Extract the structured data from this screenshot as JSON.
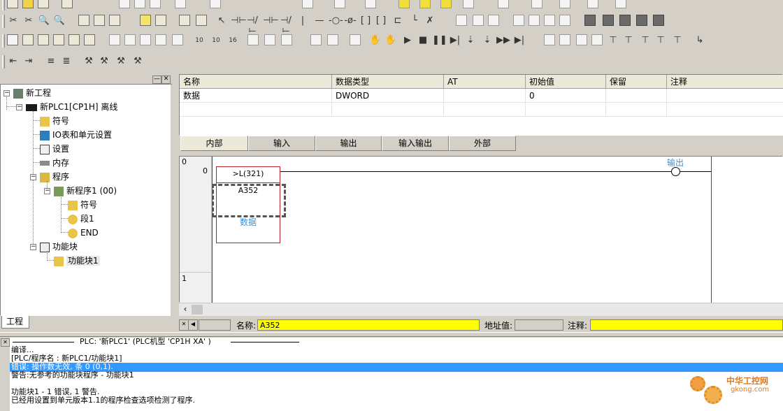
{
  "project_tree": {
    "tab_label": "工程",
    "root": "新工程",
    "plc": "新PLC1[CP1H] 离线",
    "plc_children": [
      "符号",
      "IO表和单元设置",
      "设置",
      "内存"
    ],
    "programs_label": "程序",
    "program_name": "新程序1 (00)",
    "program_children": [
      "符号",
      "段1",
      "END"
    ],
    "function_blocks_label": "功能块",
    "function_block_item": "功能块1"
  },
  "variable_table": {
    "headers": [
      "名称",
      "数据类型",
      "AT",
      "初始值",
      "保留",
      "注释"
    ],
    "row": [
      "数据",
      "DWORD",
      "",
      "0",
      "",
      ""
    ],
    "tabs": [
      "内部",
      "输入",
      "输出",
      "输入输出",
      "外部"
    ],
    "active_tab": "内部"
  },
  "ladder": {
    "rung0_number": "0",
    "rung0_step": "0",
    "rung1_number": "1",
    "instruction": ">L(321)",
    "operand1": "A352",
    "operand2": "数据",
    "coil_label": "输出"
  },
  "status": {
    "name_label": "名称:",
    "name_value": "A352",
    "address_label": "地址值:",
    "comment_label": "注释:"
  },
  "output": {
    "title": "PLC: '新PLC1' (PLC机型 'CP1H XA' )",
    "lines": [
      "编译...",
      "[PLC/程序名 : 新PLC1/功能块1]",
      "错误: 操作数无效, 条 0 (0,1).",
      "警告:无参考的功能块程序 - 功能块1",
      "",
      "功能块1 - 1 错误, 1 警告.",
      "已经用设置到单元版本1.1的程序检查选项检测了程序."
    ]
  },
  "watermark": {
    "cn": "中华工控网",
    "url": "gkong.com"
  },
  "colors": {
    "highlight": "#3399ff",
    "field": "#ffff00",
    "contact_border": "#c0202a",
    "rail": "#008000"
  }
}
